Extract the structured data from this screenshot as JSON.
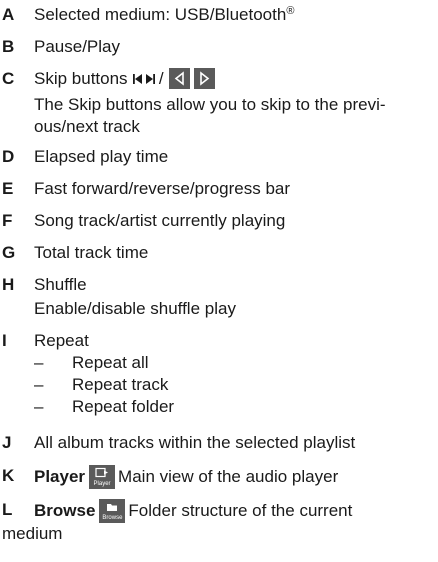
{
  "items": [
    {
      "letter": "A",
      "text": "Selected medium: USB/Bluetooth",
      "sup": "®"
    },
    {
      "letter": "B",
      "text": "Pause/Play"
    },
    {
      "letter": "C",
      "text": "Skip buttons",
      "sep": "/",
      "desc": "The Skip buttons allow you to skip to the previ-",
      "desc2": "ous/next track"
    },
    {
      "letter": "D",
      "text": "Elapsed play time"
    },
    {
      "letter": "E",
      "text": "Fast forward/reverse/progress bar"
    },
    {
      "letter": "F",
      "text": "Song track/artist currently playing"
    },
    {
      "letter": "G",
      "text": "Total track time"
    },
    {
      "letter": "H",
      "text": "Shuffle",
      "desc": "Enable/disable shuffle play"
    },
    {
      "letter": "I",
      "text": "Repeat",
      "options": [
        "Repeat all",
        "Repeat track",
        "Repeat folder"
      ],
      "dash": "–"
    },
    {
      "letter": "J",
      "text": "All album tracks within the selected playlist"
    },
    {
      "letter": "K",
      "bold": "Player",
      "icon_caption": "Player",
      "text": "Main view of the audio player",
      "icon": "player-icon"
    },
    {
      "letter": "L",
      "bold": "Browse",
      "icon_caption": "Browse",
      "text": "Folder structure of the current",
      "text2": "medium",
      "icon": "browse-icon"
    }
  ],
  "icons": {
    "skip_glyph": "skip-back-forward-glyph",
    "skip_prev": "triangle-left-icon",
    "skip_next": "triangle-right-icon",
    "icon_bg": "#5a5a5a",
    "icon_fg": "#ffffff"
  }
}
